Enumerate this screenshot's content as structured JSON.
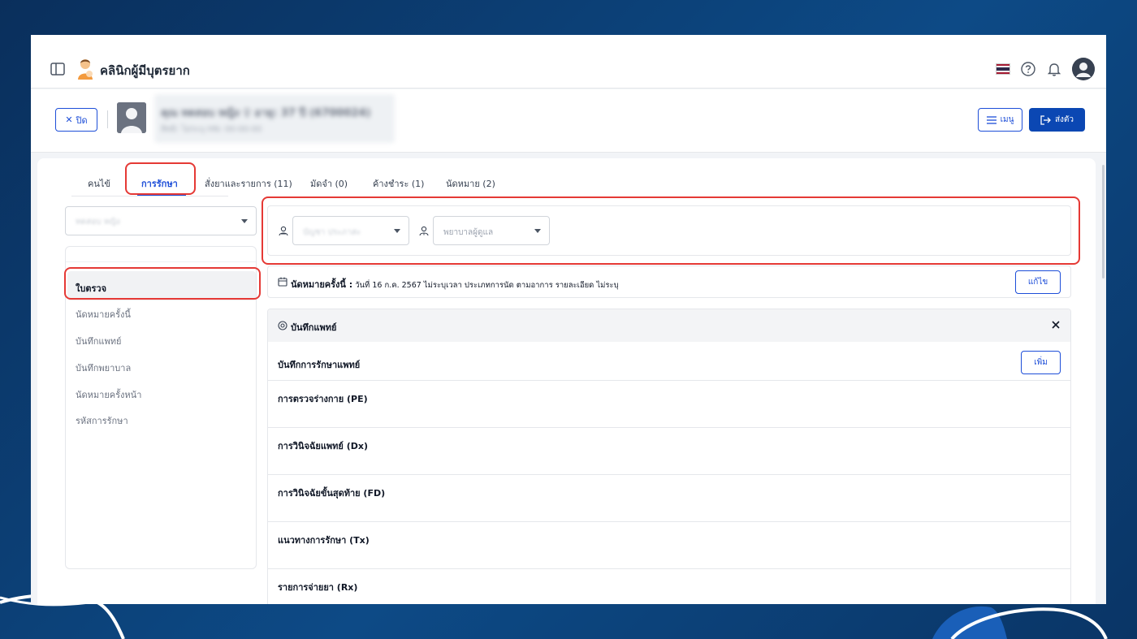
{
  "header": {
    "app_title": "คลินิกผู้มีบุตรยาก",
    "flag_colors": [
      "#a51931",
      "#f4f5f8",
      "#2d2a4a",
      "#f4f5f8",
      "#a51931"
    ],
    "icons": [
      "sidebar-toggle-icon",
      "help-icon",
      "bell-icon",
      "user-avatar"
    ]
  },
  "patient": {
    "close_label": "ปิด",
    "name_line": "คุณ ทดสอบ หญิง ♀ อายุ: 37 ปี (6700024)",
    "sub_line": "สิทธิ: ไม่ระบุ  HN: 00-00-00",
    "menu_label": "เมนู",
    "send_label": "ส่งตัว"
  },
  "tabs": [
    {
      "label": "คนไข้",
      "active": false
    },
    {
      "label": "การรักษา",
      "active": true
    },
    {
      "label": "สั่งยาและรายการ (11)",
      "active": false
    },
    {
      "label": "มัดจำ (0)",
      "active": false
    },
    {
      "label": "ค้างชำระ (1)",
      "active": false
    },
    {
      "label": "นัดหมาย (2)",
      "active": false
    }
  ],
  "patient_select": {
    "placeholder": "ทดสอบ หญิง"
  },
  "left_nav": [
    {
      "label": "ใบตรวจ",
      "active": true
    },
    {
      "label": "นัดหมายครั้งนี้",
      "active": false
    },
    {
      "label": "บันทึกแพทย์",
      "active": false
    },
    {
      "label": "บันทึกพยาบาล",
      "active": false
    },
    {
      "label": "นัดหมายครั้งหน้า",
      "active": false
    },
    {
      "label": "รหัสการรักษา",
      "active": false
    }
  ],
  "filters": {
    "doctor_placeholder": "บัญชา ประภาสะ",
    "nurse_placeholder": "พยาบาลผู้ดูแล"
  },
  "appointment": {
    "title": "นัดหมายครั้งนี้ :",
    "detail": "วันที่ 16 ก.ค. 2567 ไม่ระบุเวลา   ประเภทการนัด ตามอาการ   รายละเอียด ไม่ระบุ",
    "edit_label": "แก้ไข"
  },
  "doctor_note": {
    "header": "บันทึกแพทย์",
    "subheader": "บันทึกการรักษาแพทย์",
    "add_label": "เพิ่ม",
    "sections": [
      "การตรวจร่างกาย (PE)",
      "การวินิจฉัยแพทย์ (Dx)",
      "การวินิจฉัยขั้นสุดท้าย (FD)",
      "แนวทางการรักษา (Tx)",
      "รายการจ่ายยา (Rx)"
    ]
  },
  "colors": {
    "primary": "#1d4ed8",
    "primary_dark": "#0b47b3",
    "highlight": "#e53935",
    "backdrop": "#0b3a6e"
  }
}
